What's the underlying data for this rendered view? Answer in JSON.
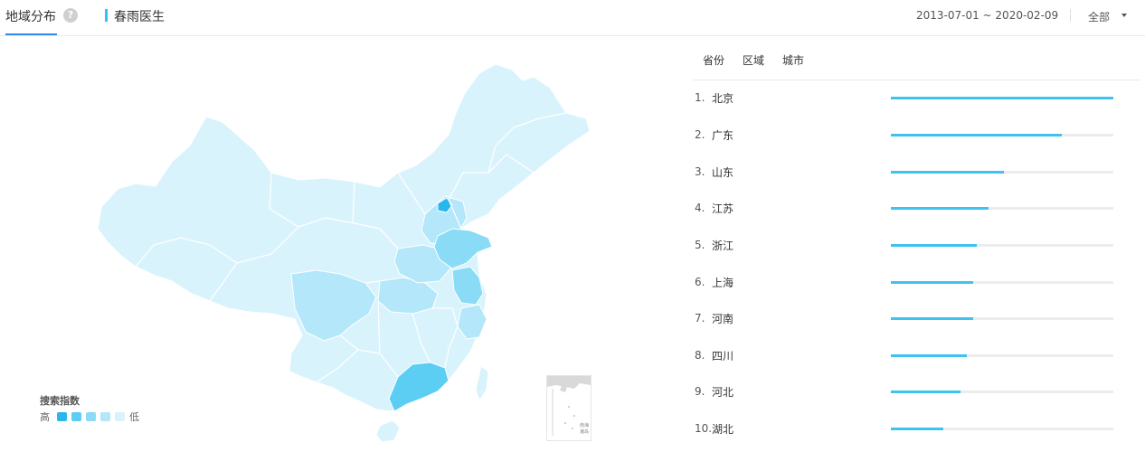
{
  "header": {
    "tab_title": "地域分布",
    "help_icon": "question-circle-icon",
    "keyword": "春雨医生",
    "date_range": "2013-07-01 ~ 2020-02-09",
    "scope": "全部"
  },
  "legend": {
    "title": "搜索指数",
    "high_label": "高",
    "low_label": "低",
    "colors": [
      "#29b6ec",
      "#5ccdf3",
      "#89dbf6",
      "#b4e7fa",
      "#d9f3fd"
    ]
  },
  "inset": {
    "label": "南海诸岛"
  },
  "ranking": {
    "tabs": [
      "省份",
      "区域",
      "城市"
    ],
    "items": [
      {
        "index": "1.",
        "name": "北京",
        "share": 1.0
      },
      {
        "index": "2.",
        "name": "广东",
        "share": 0.77
      },
      {
        "index": "3.",
        "name": "山东",
        "share": 0.51
      },
      {
        "index": "4.",
        "name": "江苏",
        "share": 0.44
      },
      {
        "index": "5.",
        "name": "浙江",
        "share": 0.385
      },
      {
        "index": "6.",
        "name": "上海",
        "share": 0.37
      },
      {
        "index": "7.",
        "name": "河南",
        "share": 0.37
      },
      {
        "index": "8.",
        "name": "四川",
        "share": 0.34
      },
      {
        "index": "9.",
        "name": "河北",
        "share": 0.315
      },
      {
        "index": "10.",
        "name": "湖北",
        "share": 0.235
      }
    ]
  },
  "colors": {
    "accent": "#2f8be6",
    "bar": "#3ec3ef",
    "map_base": "#d9f3fd"
  }
}
